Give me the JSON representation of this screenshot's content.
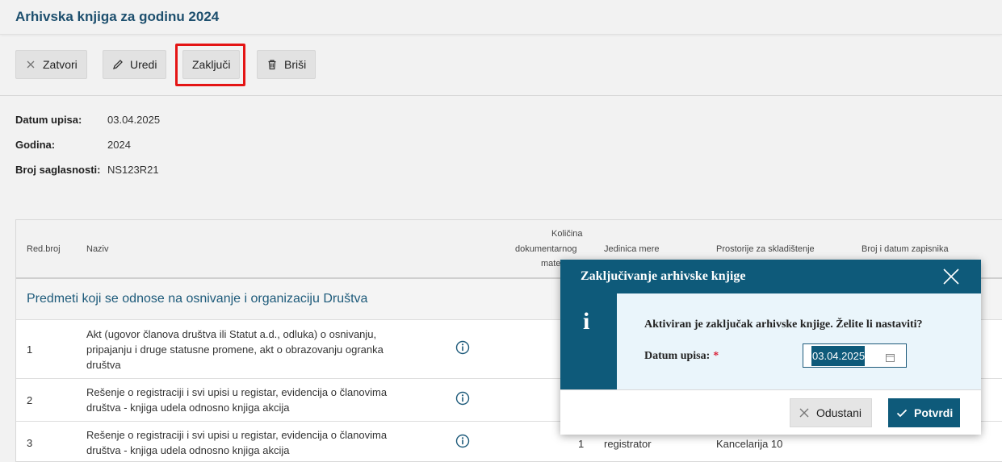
{
  "header": {
    "title": "Arhivska knjiga za godinu 2024"
  },
  "toolbar": {
    "close_label": "Zatvori",
    "edit_label": "Uredi",
    "conclude_label": "Zaključi",
    "delete_label": "Briši"
  },
  "details": {
    "datum_upisa_label": "Datum upisa:",
    "datum_upisa_value": "03.04.2025",
    "godina_label": "Godina:",
    "godina_value": "2024",
    "broj_saglasnosti_label": "Broj saglasnosti:",
    "broj_saglasnosti_value": "NS123R21"
  },
  "table": {
    "columns": {
      "red_broj": "Red.broj",
      "naziv": "Naziv",
      "kolicina_1": "Količina",
      "kolicina_2": "dokumentarnog",
      "kolicina_3": "mate",
      "jedinica": "Jedinica mere",
      "prostorije": "Prostorije za skladištenje",
      "zapisnik": "Broj i datum zapisnika"
    },
    "group_title": "Predmeti koji se odnose na osnivanje i organizaciju Društva",
    "rows": [
      {
        "num": "1",
        "name": "Akt (ugovor članova društva ili Statut a.d., odluka) o osnivanju, pripajanju i druge statusne promene, akt o obrazovanju ogranka društva",
        "qty": "",
        "unit": "",
        "room": ""
      },
      {
        "num": "2",
        "name": "Rešenje o registraciji i svi upisi u registar, evidencija o članovima društva - knjiga udela odnosno knjiga akcija",
        "qty": "",
        "unit": "",
        "room": ""
      },
      {
        "num": "3",
        "name": "Rešenje o registraciji i svi upisi u registar, evidencija o članovima društva - knjiga udela odnosno knjiga akcija",
        "qty": "1",
        "unit": "registrator",
        "room": "Kancelarija 10"
      }
    ]
  },
  "modal": {
    "title": "Zaključivanje arhivske knjige",
    "side_icon": "i",
    "message": "Aktiviran je zaključak arhivske knjige. Želite li nastaviti?",
    "date_label": "Datum upisa:",
    "required_mark": "*",
    "date_value": "03.04.2025",
    "cancel_label": "Odustani",
    "confirm_label": "Potvrdi"
  },
  "colors": {
    "primary": "#0e5a7a",
    "title": "#1d4f6e",
    "highlight": "#e41414",
    "modal_body_bg": "#eaf5fb",
    "required": "#d9233a"
  },
  "icons": {
    "close": "close-icon",
    "edit": "pencil-icon",
    "delete": "trash-icon",
    "info": "info-circle-icon",
    "calendar": "calendar-icon",
    "check": "check-icon"
  }
}
